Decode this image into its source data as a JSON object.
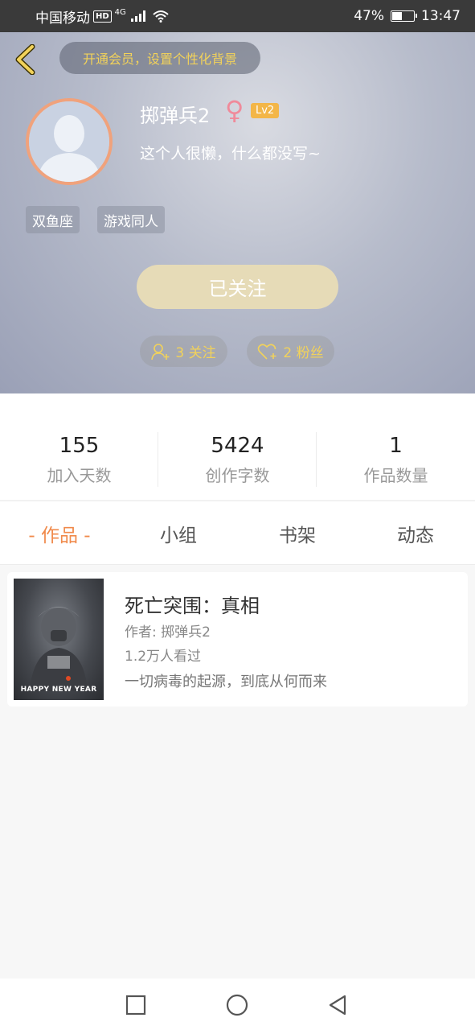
{
  "status_bar": {
    "carrier": "中国移动",
    "hd_badge": "HD",
    "network": "4G",
    "battery_percent": "47%",
    "time": "13:47"
  },
  "header": {
    "vip_prompt": "开通会员，设置个性化背景",
    "username": "掷弹兵2",
    "gender_symbol": "♀",
    "level": "Lv2",
    "bio": "这个人很懒，什么都没写~",
    "tags": [
      "双鱼座",
      "游戏同人"
    ],
    "follow_button_label": "已关注",
    "following_label": "3 关注",
    "fans_label": "2 粉丝"
  },
  "stats": [
    {
      "value": "155",
      "label": "加入天数"
    },
    {
      "value": "5424",
      "label": "创作字数"
    },
    {
      "value": "1",
      "label": "作品数量"
    }
  ],
  "tabs": [
    {
      "label": "- 作品 -",
      "active": true
    },
    {
      "label": "小组",
      "active": false
    },
    {
      "label": "书架",
      "active": false
    },
    {
      "label": "动态",
      "active": false
    }
  ],
  "works": [
    {
      "title": "死亡突围：真相",
      "author": "作者: 掷弹兵2",
      "views": "1.2万人看过",
      "description": "一切病毒的起源，到底从何而来",
      "cover_text": "HAPPY NEW YEAR"
    }
  ],
  "colors": {
    "accent_orange": "#f08a4b",
    "vip_yellow": "#f2d25a",
    "follow_button": "#e6dbb7",
    "level_badge": "#f3b648",
    "gender_pink": "#f08a9a"
  },
  "icons": {
    "back": "chevron-left-icon",
    "following": "user-add-icon",
    "fans": "heart-add-icon",
    "nav_recent": "square-icon",
    "nav_home": "circle-icon",
    "nav_back": "triangle-back-icon"
  }
}
